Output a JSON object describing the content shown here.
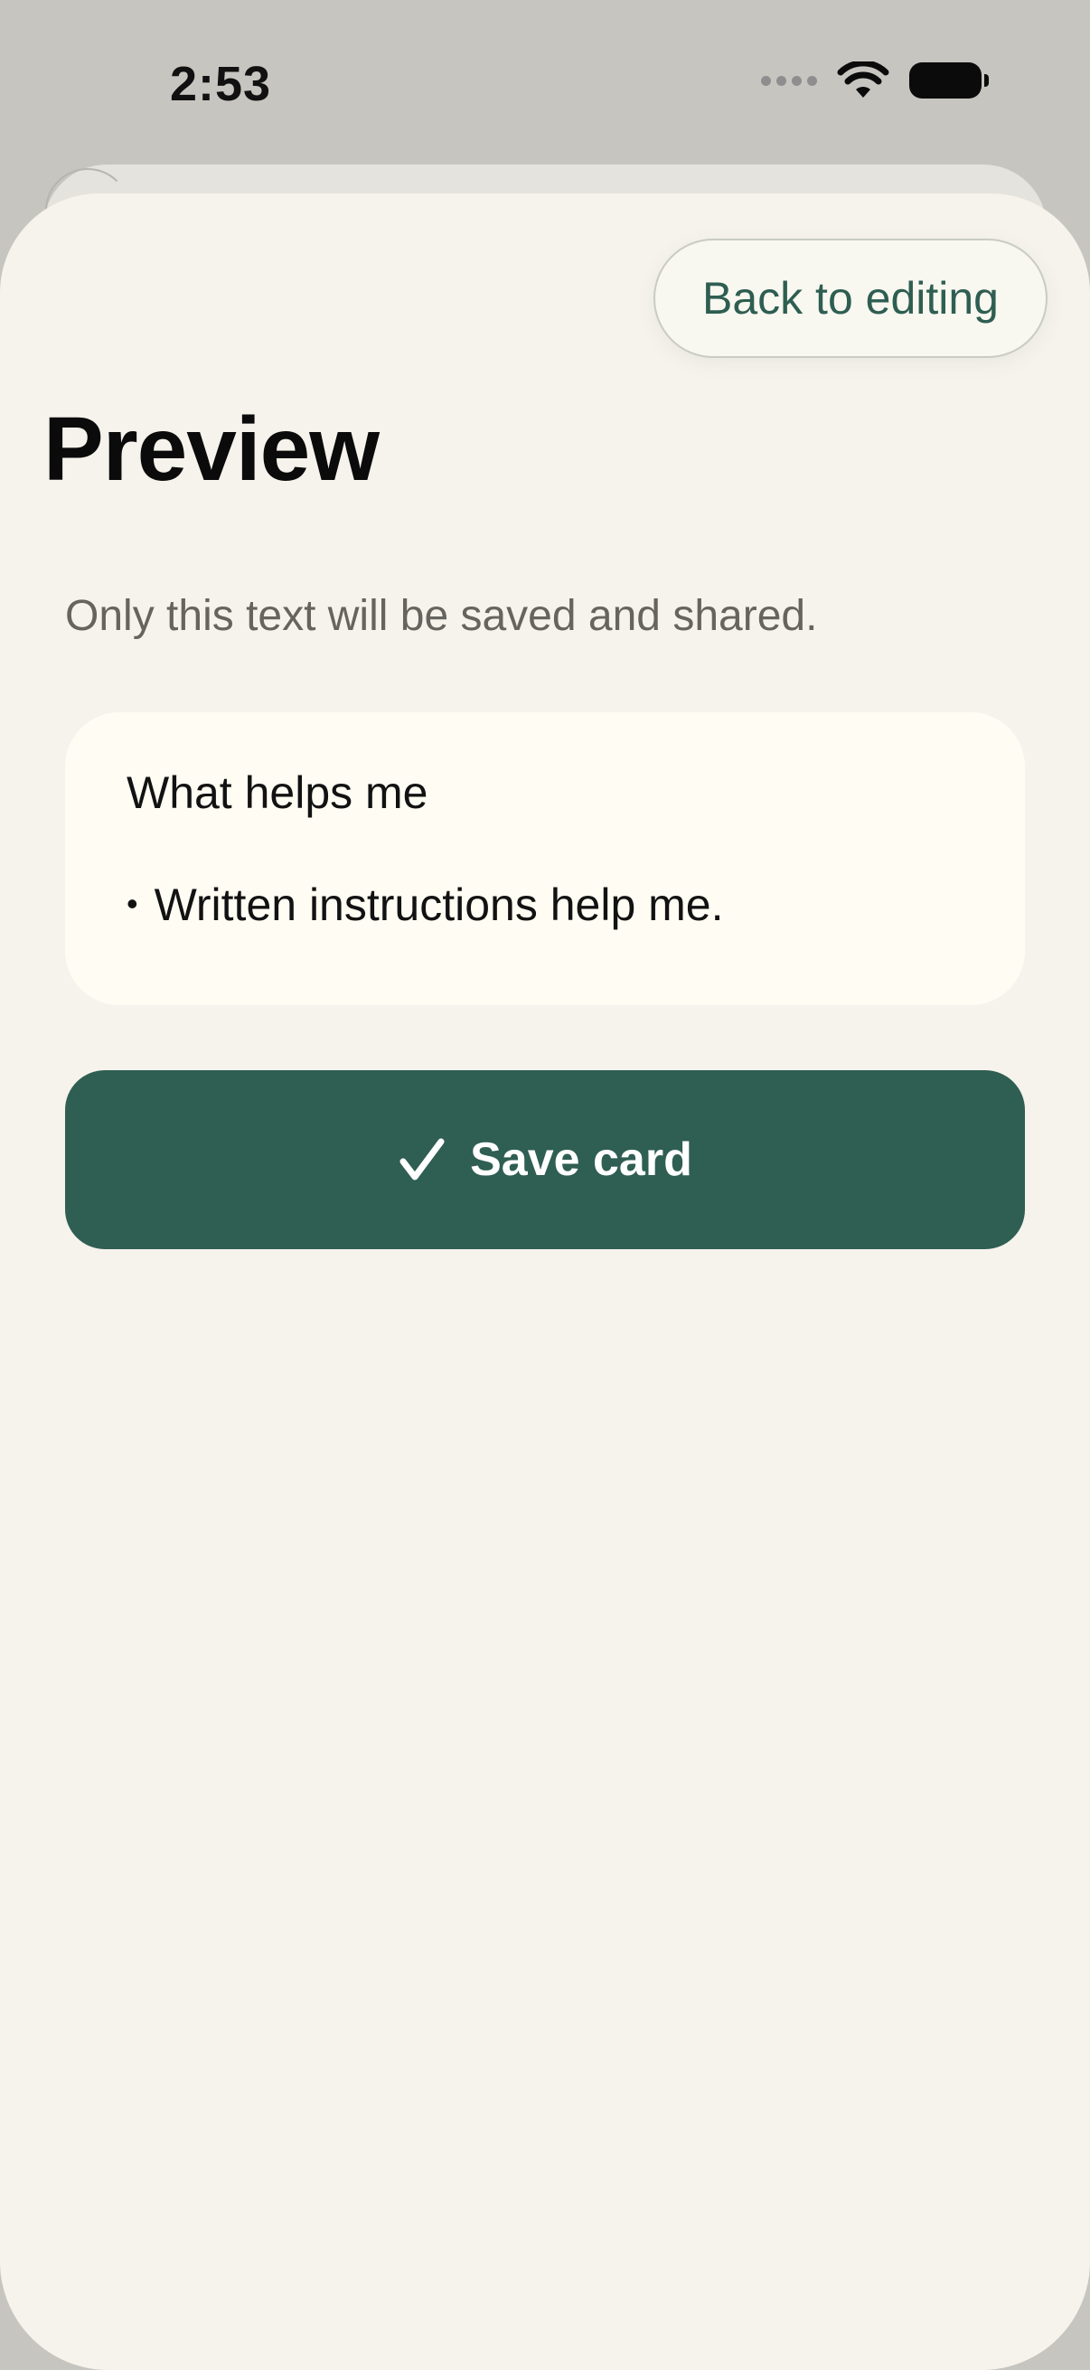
{
  "status_bar": {
    "time": "2:53",
    "icons": [
      "cellular-signal-icon",
      "wifi-icon",
      "battery-icon"
    ]
  },
  "header": {
    "back_button_label": "Back to editing"
  },
  "page": {
    "title": "Preview",
    "subtitle": "Only this text will be saved and shared."
  },
  "card": {
    "heading": "What helps me",
    "bullet_marker": "•",
    "items": [
      "Written instructions help me."
    ]
  },
  "actions": {
    "save_label": "Save card",
    "save_icon": "checkmark-icon"
  },
  "colors": {
    "accent": "#2f5e53",
    "sheet_background": "#f6f3ec",
    "card_background": "#fefcf3",
    "backdrop": "#c6c5c0"
  }
}
